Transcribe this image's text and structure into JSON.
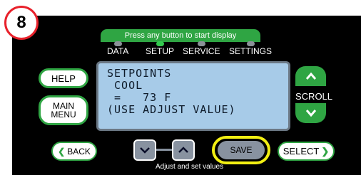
{
  "step_number": "8",
  "banner": "Press any button to start display",
  "tabs": [
    {
      "label": "DATA",
      "active": false
    },
    {
      "label": "SETUP",
      "active": true
    },
    {
      "label": "SERVICE",
      "active": false
    },
    {
      "label": "SETTINGS",
      "active": false
    }
  ],
  "left_buttons": {
    "help": "HELP",
    "main_menu_line1": "MAIN",
    "main_menu_line2": "MENU"
  },
  "lcd": {
    "line1": "SETPOINTS",
    "line2": " COOL",
    "line3": " =   73 F",
    "line4": "(USE ADJUST VALUE)"
  },
  "scroll": {
    "label": "SCROLL",
    "up_icon": "chevron-up-icon",
    "down_icon": "chevron-down-icon"
  },
  "bottom": {
    "back": "BACK",
    "save": "SAVE",
    "select": "SELECT",
    "hint": "Adjust and set values"
  },
  "colors": {
    "accent_green": "#2fa543",
    "lcd_background": "#a7cbe8",
    "highlight_yellow": "#f2ef13",
    "badge_red": "#e8212b"
  }
}
